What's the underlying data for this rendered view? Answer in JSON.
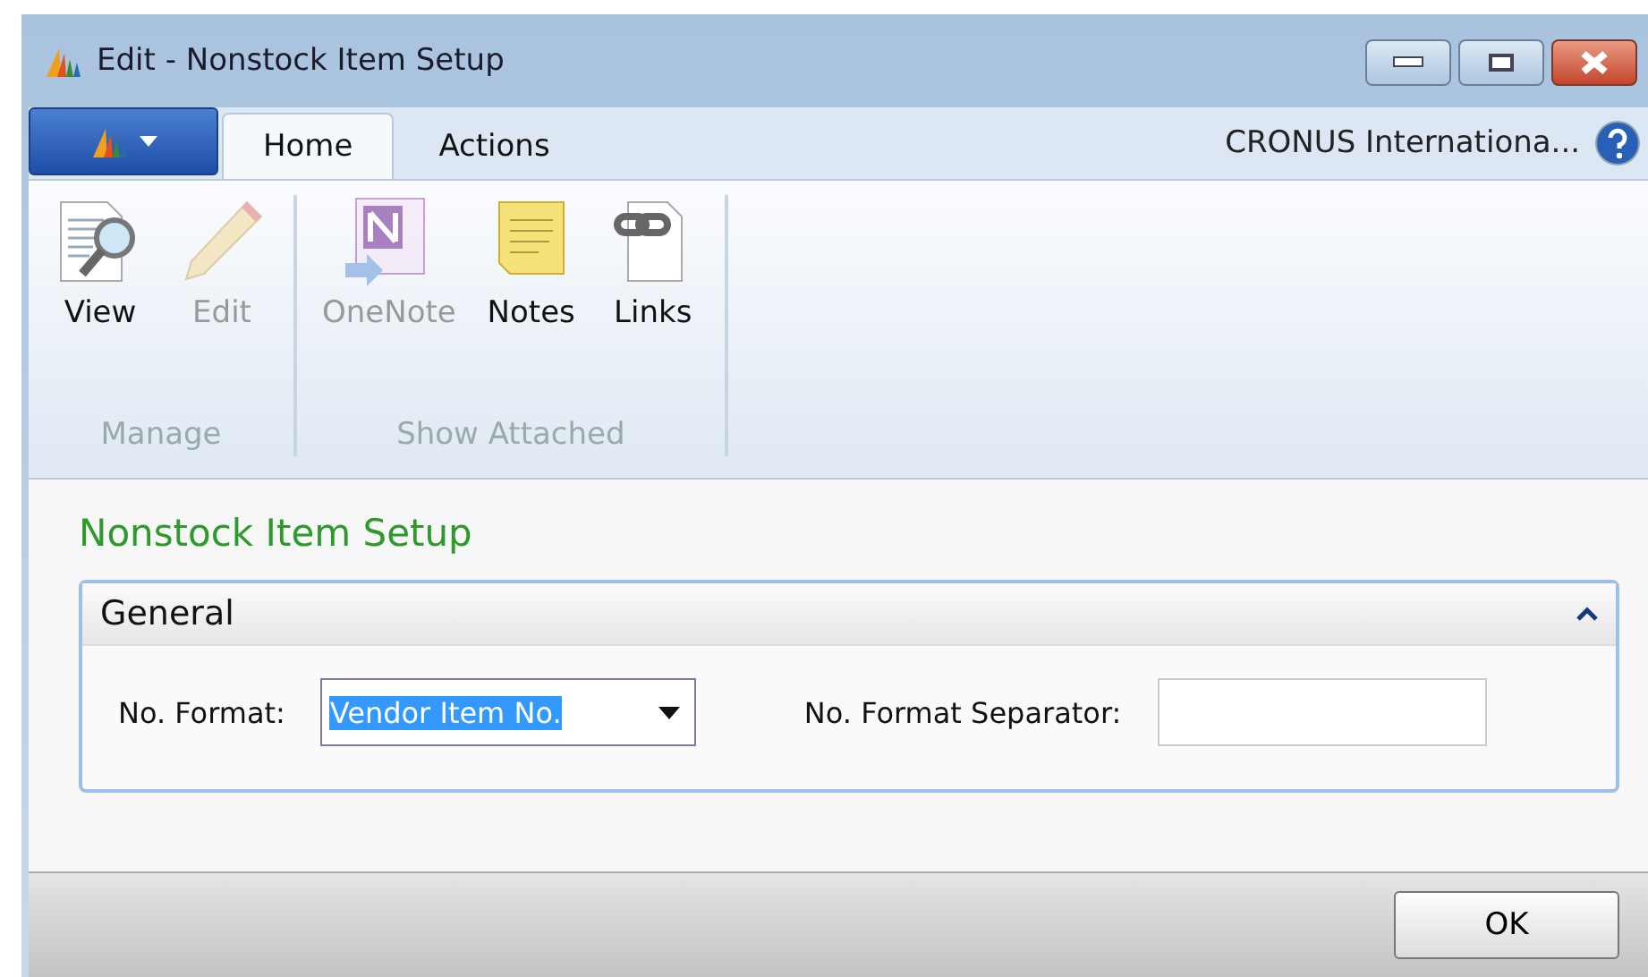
{
  "window": {
    "title": "Edit - Nonstock Item Setup"
  },
  "tabs": [
    {
      "label": "Home",
      "selected": true
    },
    {
      "label": "Actions",
      "selected": false
    }
  ],
  "company": "CRONUS Internationa...",
  "ribbon_groups": [
    {
      "label": "Manage",
      "items": [
        {
          "label": "View",
          "kind": "view",
          "disabled": false
        },
        {
          "label": "Edit",
          "kind": "edit",
          "disabled": true
        }
      ]
    },
    {
      "label": "Show Attached",
      "items": [
        {
          "label": "OneNote",
          "kind": "onenote",
          "disabled": true
        },
        {
          "label": "Notes",
          "kind": "notes",
          "disabled": false
        },
        {
          "label": "Links",
          "kind": "links",
          "disabled": false
        }
      ]
    }
  ],
  "page_title": "Nonstock Item Setup",
  "section": {
    "title": "General",
    "expanded": true,
    "fields": [
      {
        "label": "No. Format:",
        "kind": "dropdown",
        "value": "Vendor Item No.",
        "selected": true
      },
      {
        "label": "No. Format Separator:",
        "kind": "text"
      }
    ]
  },
  "buttons": [
    "OK"
  ]
}
